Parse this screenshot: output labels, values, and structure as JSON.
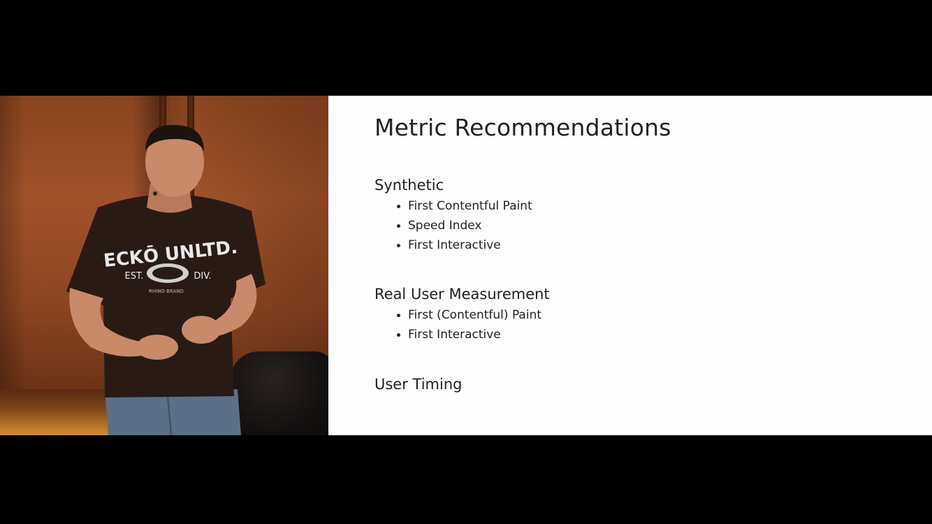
{
  "slide": {
    "title": "Metric Recommendations",
    "sections": [
      {
        "heading": "Synthetic",
        "bullets": [
          "First Contentful Paint",
          "Speed Index",
          "First Interactive"
        ]
      },
      {
        "heading": "Real User Measurement",
        "bullets": [
          "First (Contentful) Paint",
          "First Interactive"
        ]
      },
      {
        "heading": "User Timing",
        "bullets": []
      }
    ]
  },
  "speaker": {
    "shirt_text_main": "ECKŌ UNLTD.",
    "shirt_text_left": "EST.",
    "shirt_text_right": "DIV.",
    "shirt_text_bottom": "RHINO BRAND"
  },
  "colors": {
    "letterbox": "#000000",
    "slide_background": "#fefefe",
    "slide_text": "#222222",
    "wood_wall": "#8a4520"
  }
}
